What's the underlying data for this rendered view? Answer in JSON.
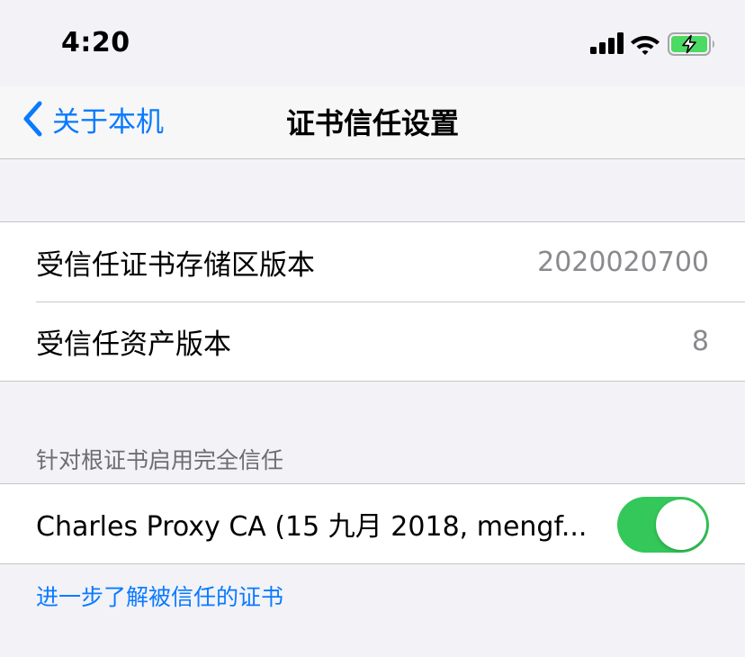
{
  "status_bar": {
    "time": "4:20",
    "icons": [
      "signal-icon",
      "wifi-icon",
      "battery-charging-icon"
    ],
    "battery_color": "#4cd964"
  },
  "nav": {
    "back_label": "关于本机",
    "title": "证书信任设置",
    "accent_color": "#0a7aff"
  },
  "info_rows": [
    {
      "label": "受信任证书存储区版本",
      "value": "2020020700"
    },
    {
      "label": "受信任资产版本",
      "value": "8"
    }
  ],
  "trust_section": {
    "header": "针对根证书启用完全信任",
    "certificates": [
      {
        "label": "Charles Proxy CA (15 九月 2018, mengf...",
        "enabled": true
      }
    ],
    "toggle_on_color": "#34c759"
  },
  "footer": {
    "learn_more_link": "进一步了解被信任的证书"
  }
}
